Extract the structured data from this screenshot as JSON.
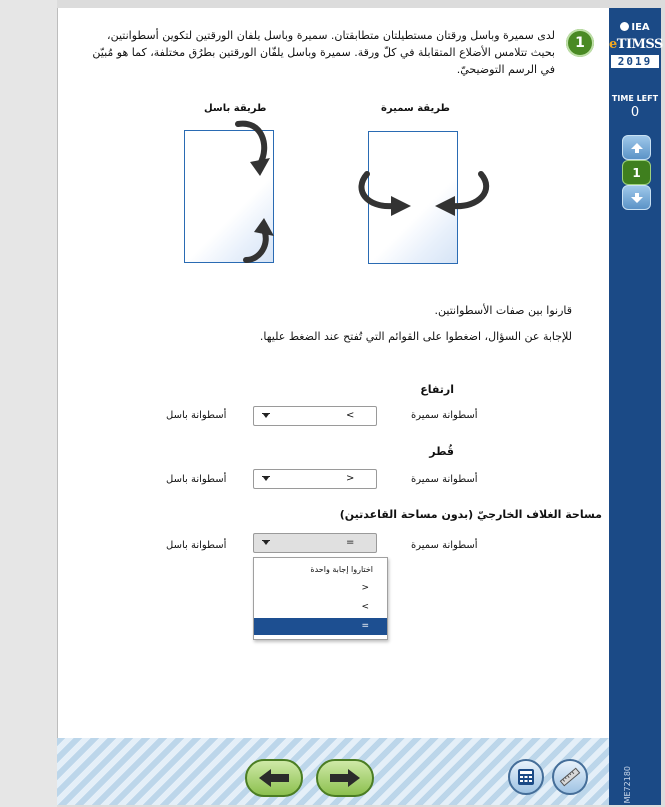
{
  "sidebar": {
    "logo_iea": "IEA",
    "logo_etimss_e": "e",
    "logo_etimss_rest": "TIMSS",
    "logo_year": "2019",
    "time_label": "TIME LEFT",
    "time_value": "0",
    "current_item": "1",
    "item_code": "ME72180"
  },
  "question": {
    "number": "1",
    "intro": "لدى سميرة وباسل ورقتان مستطيلتان متطابقتان. سميرة وباسل يلفان الورقتين لتكوين أسطوانتين، بحيث تتلامس الأضلاع المتقابلة في كلّ ورقة. سميرة وباسل يلفّان الورقتين بطرُق مختلفة، كما هو مُبيّن في الرسم التوضيحيّ.",
    "method_samira": "طريقة سميرة",
    "method_basel": "طريقة باسل",
    "compare_text": "قارنوا بين صفات الأسطوانتين.",
    "instruction_text": "للإجابة عن السؤال، اضغطوا على القوائم التي تُفتح عند الضغط عليها."
  },
  "rows": [
    {
      "title": "ارتفاع",
      "left_label": "أسطوانة سميرة",
      "right_label": "أسطوانة باسل",
      "selected": "<"
    },
    {
      "title": "قُطر",
      "left_label": "أسطوانة سميرة",
      "right_label": "أسطوانة باسل",
      "selected": ">"
    },
    {
      "title": "مساحة الغلاف الخارجيّ (بدون مساحة القاعدتين)",
      "left_label": "أسطوانة سميرة",
      "right_label": "أسطوانة باسل",
      "selected": "="
    }
  ],
  "dropdown": {
    "placeholder": "اختاروا إجابة واحدة",
    "options": [
      "<",
      ">",
      "="
    ],
    "highlighted": "="
  },
  "toolbar": {
    "back": "back-arrow-icon",
    "next": "next-arrow-icon",
    "calculator": "calculator-icon",
    "ruler": "ruler-icon"
  }
}
